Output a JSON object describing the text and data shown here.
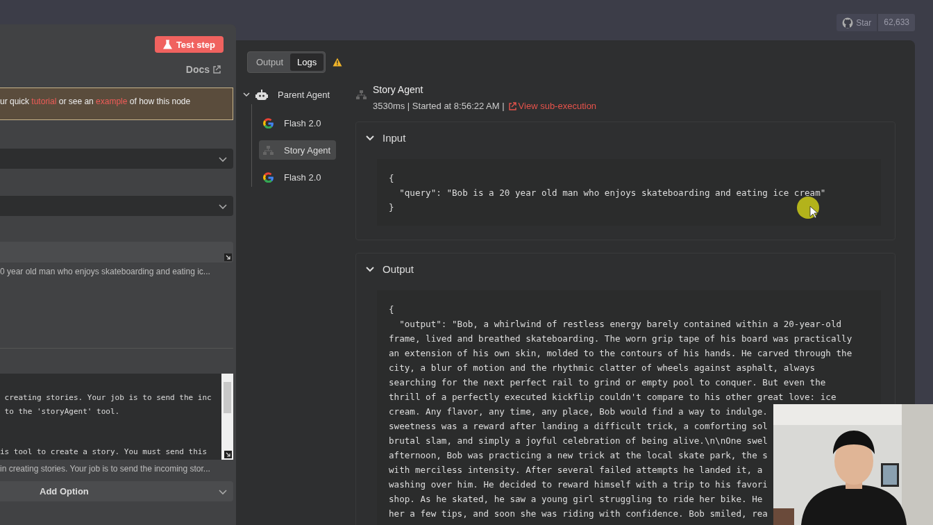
{
  "header": {
    "star_button": {
      "label": "Star",
      "count": "62,633"
    }
  },
  "node_panel": {
    "test_button": "Test step",
    "docs_link": "Docs",
    "notice": [
      {
        "kind": "text",
        "text": "ur quick "
      },
      {
        "kind": "link",
        "text": "tutorial"
      },
      {
        "kind": "text",
        "text": " or see an "
      },
      {
        "kind": "link",
        "text": "example"
      },
      {
        "kind": "text",
        "text": " of how this node"
      }
    ],
    "prompt_preview": "0 year old man who enjoys skateboarding and eating ic...",
    "system_message": {
      "paragraphs": [
        [
          " creating stories. Your job is to send the inc",
          " to the 'storyAgent' tool."
        ],
        [
          "is tool to create a story. You must send this"
        ]
      ],
      "preview": "in creating stories. Your job is to send the incoming stor..."
    },
    "add_option": "Add Option"
  },
  "logs_panel": {
    "tabs": [
      {
        "label": "Output",
        "selected": false
      },
      {
        "label": "Logs",
        "selected": true
      }
    ],
    "tree": [
      {
        "label": "Parent Agent",
        "kind": "agent",
        "expanded": true,
        "selected": false,
        "children": [
          {
            "label": "Flash 2.0",
            "kind": "model",
            "selected": false
          },
          {
            "label": "Story Agent",
            "kind": "tool",
            "selected": true
          },
          {
            "label": "Flash 2.0",
            "kind": "model",
            "selected": false
          }
        ]
      }
    ],
    "detail": {
      "title": "Story Agent",
      "meta": "3530ms | Started at 8:56:22 AM |",
      "link": "View sub-execution",
      "sections": [
        {
          "title": "Input",
          "expanded": true,
          "lines": [
            "{",
            "  \"query\": \"Bob is a 20 year old man who enjoys skateboarding and eating ice cream\"",
            "}"
          ]
        },
        {
          "title": "Output",
          "expanded": true,
          "lines": [
            "{",
            "  \"output\": \"Bob, a whirlwind of restless energy barely contained within a 20-year-old",
            "frame, lived and breathed skateboarding. The worn grip tape of his board was practically",
            "an extension of his own skin, molded to the contours of his hands. He carved through the",
            "city, a blur of motion and the rhythmic clatter of wheels against asphalt, always",
            "searching for the next perfect rail to grind or empty pool to conquer. But even the",
            "thrill of a perfectly executed kickflip couldn't compare to his other great love: ice",
            "cream. Any flavor, any time, any place, Bob would find a way to indulge.",
            "sweetness was a reward after landing a difficult trick, a comforting sol",
            "brutal slam, and simply a joyful celebration of being alive.\\n\\nOne swel",
            "afternoon, Bob was practicing a new trick at the local skate park, the s",
            "with merciless intensity. After several failed attempts he landed it, a",
            "washing over him. He decided to reward himself with a trip to his favori",
            "shop. As he skated, he saw a young girl struggling to ride her bike. He",
            "her a few tips, and soon she was riding with confidence. Bob smiled, rea"
          ]
        }
      ]
    }
  }
}
